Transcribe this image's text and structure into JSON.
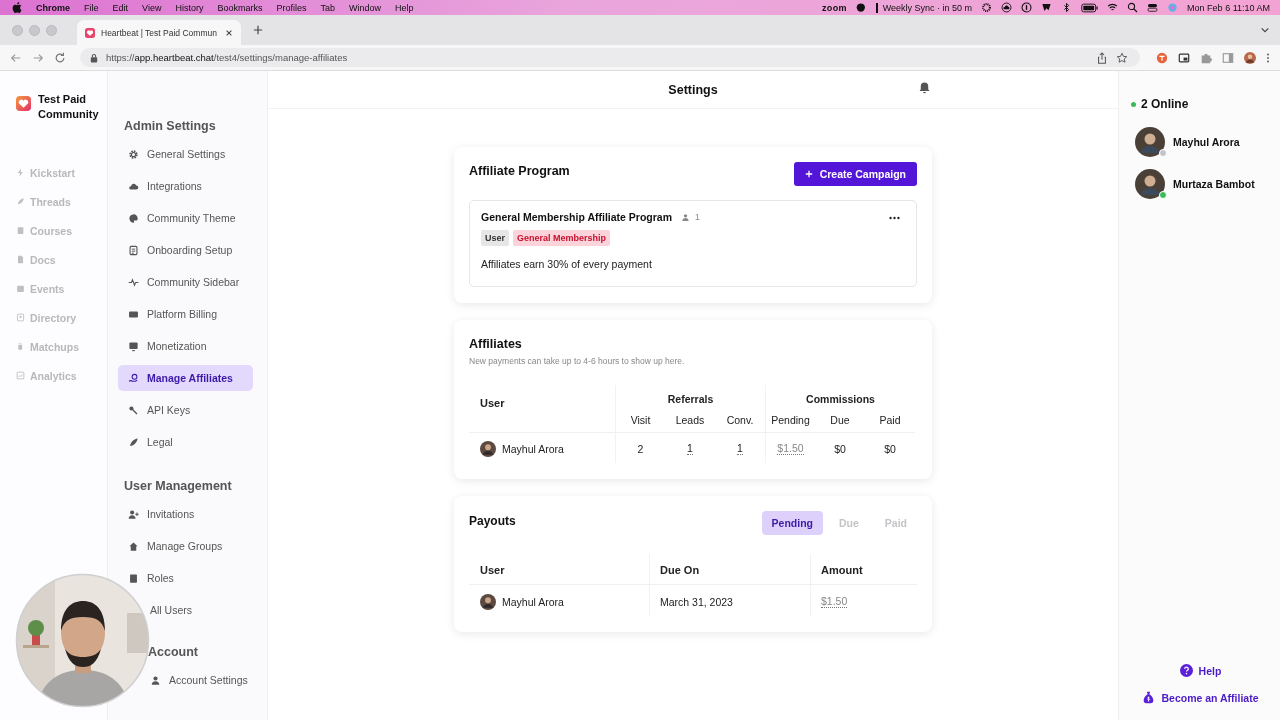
{
  "menu_bar": {
    "app": "Chrome",
    "items": [
      "File",
      "Edit",
      "View",
      "History",
      "Bookmarks",
      "Profiles",
      "Tab",
      "Window",
      "Help"
    ],
    "zoom": "zoom",
    "meeting": "Weekly Sync · in 50 m",
    "clock": "Mon Feb 6  11:10 AM"
  },
  "browser": {
    "tab_title": "Heartbeat | Test Paid Commun",
    "url": "https://**app.heartbeat.chat**/test4/settings/manage-affiliates"
  },
  "community": {
    "name": "Test Paid Community"
  },
  "rail": [
    "Kickstart",
    "Threads",
    "Courses",
    "Docs",
    "Events",
    "Directory",
    "Matchups",
    "Analytics"
  ],
  "settings_sidebar": [
    {
      "title": "Admin Settings",
      "items": [
        {
          "label": "General Settings",
          "selected": false
        },
        {
          "label": "Integrations",
          "selected": false
        },
        {
          "label": "Community Theme",
          "selected": false
        },
        {
          "label": "Onboarding Setup",
          "selected": false
        },
        {
          "label": "Community Sidebar",
          "selected": false
        },
        {
          "label": "Platform Billing",
          "selected": false
        },
        {
          "label": "Monetization",
          "selected": false
        },
        {
          "label": "Manage Affiliates",
          "selected": true
        },
        {
          "label": "API Keys",
          "selected": false
        },
        {
          "label": "Legal",
          "selected": false
        }
      ]
    },
    {
      "title": "User Management",
      "items": [
        {
          "label": "Invitations",
          "selected": false
        },
        {
          "label": "Manage Groups",
          "selected": false
        },
        {
          "label": "Roles",
          "selected": false
        },
        {
          "label": "All Users",
          "selected": false
        }
      ]
    },
    {
      "title": "Account",
      "items": [
        {
          "label": "Account Settings",
          "selected": false
        }
      ]
    }
  ],
  "header": {
    "title": "Settings"
  },
  "affiliate_program": {
    "title": "Affiliate Program",
    "button": "Create Campaign",
    "program": {
      "name": "General Membership Affiliate Program",
      "members": "1",
      "tags": [
        {
          "label": "User",
          "color": "#e6e6e6"
        },
        {
          "label": "General Membership",
          "color": "#fbd3da"
        }
      ],
      "description": "Affiliates earn 30% of every payment"
    }
  },
  "affiliates": {
    "title": "Affiliates",
    "note": "New payments can take up to 4-6 hours to show up here.",
    "user_column": "User",
    "groups": [
      {
        "label": "Referrals",
        "columns": [
          "Visit",
          "Leads",
          "Conv."
        ]
      },
      {
        "label": "Commissions",
        "columns": [
          "Pending",
          "Due",
          "Paid"
        ]
      }
    ],
    "rows": [
      {
        "user": "Mayhul Arora",
        "values": [
          "2",
          "1",
          "1",
          "$1.50",
          "$0",
          "$0"
        ]
      }
    ]
  },
  "payouts": {
    "title": "Payouts",
    "tabs": [
      {
        "label": "Pending",
        "selected": true
      },
      {
        "label": "Due",
        "selected": false
      },
      {
        "label": "Paid",
        "selected": false
      }
    ],
    "columns": [
      "User",
      "Due On",
      "Amount"
    ],
    "rows": [
      {
        "user": "Mayhul Arora",
        "due_on": "March 31, 2023",
        "amount": "$1.50"
      }
    ]
  },
  "online": {
    "title": "2 Online",
    "users": [
      {
        "name": "Mayhul Arora",
        "color": "#c4c4c8"
      },
      {
        "name": "Murtaza Bambot",
        "color": "#3cb95a"
      }
    ],
    "help": "Help",
    "affiliate_link": "Become an Affiliate"
  }
}
